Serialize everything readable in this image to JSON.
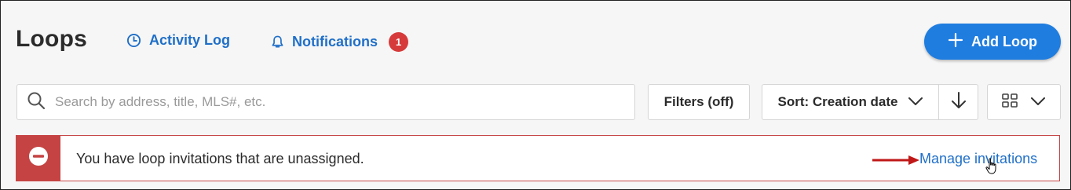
{
  "header": {
    "title": "Loops",
    "activity_log": "Activity Log",
    "notifications": "Notifications",
    "notifications_count": "1",
    "add_loop": "Add Loop"
  },
  "toolbar": {
    "search_placeholder": "Search by address, title, MLS#, etc.",
    "search_value": "",
    "filters": "Filters (off)",
    "sort": "Sort: Creation date"
  },
  "alert": {
    "message": "You have loop invitations that are unassigned.",
    "action": "Manage invitations"
  },
  "colors": {
    "accent": "#1f7de0",
    "link": "#1f6fc8",
    "danger": "#c54343",
    "badge": "#d63a3a"
  },
  "icons": [
    "clock-icon",
    "bell-icon",
    "plus-icon",
    "search-icon",
    "chevron-down-icon",
    "arrow-down-icon",
    "grid-view-icon",
    "minus-circle-icon",
    "red-arrow-icon",
    "hand-cursor-icon"
  ]
}
